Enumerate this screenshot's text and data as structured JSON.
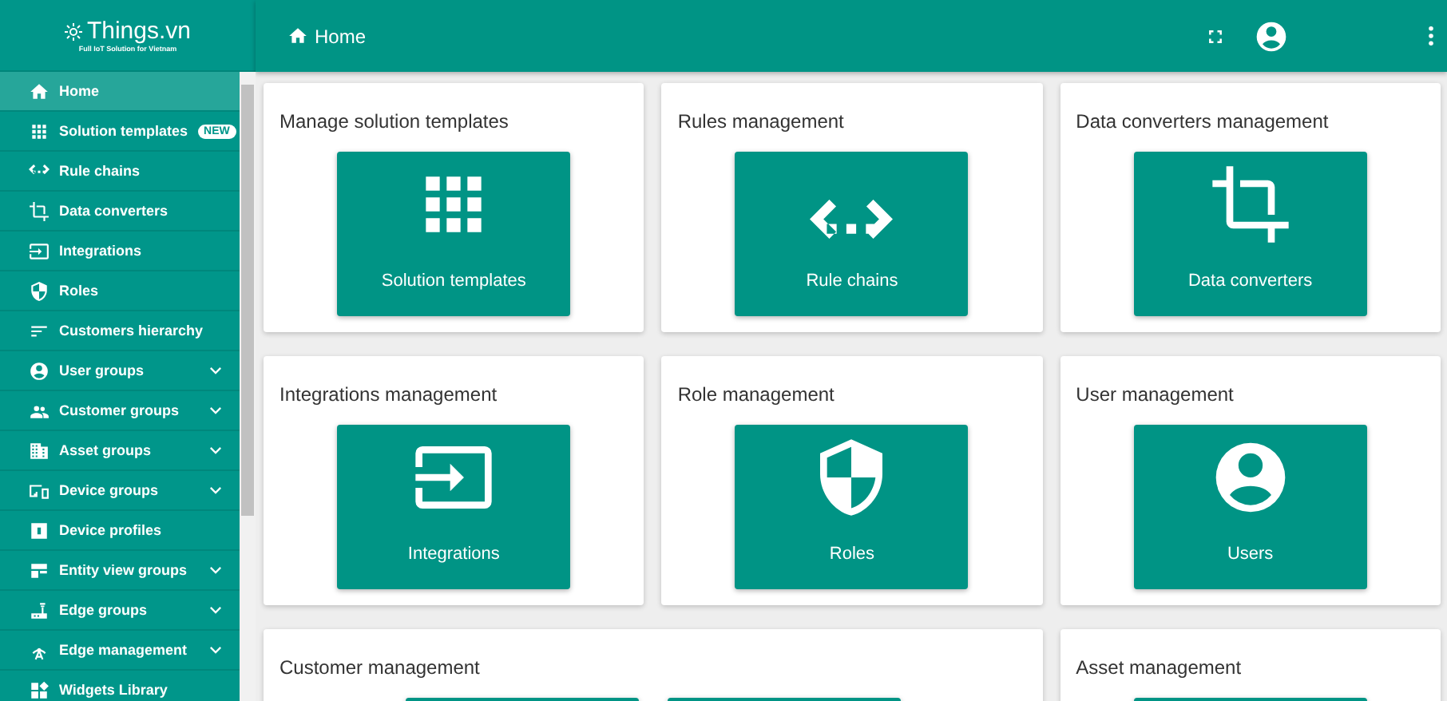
{
  "logo": {
    "name": "Things.vn",
    "tagline": "Full IoT Solution for Vietnam"
  },
  "sidebar": {
    "items": [
      {
        "label": "Home",
        "selected": true,
        "expandable": false
      },
      {
        "label": "Solution templates",
        "selected": false,
        "expandable": false,
        "badge": "NEW"
      },
      {
        "label": "Rule chains",
        "selected": false,
        "expandable": false
      },
      {
        "label": "Data converters",
        "selected": false,
        "expandable": false
      },
      {
        "label": "Integrations",
        "selected": false,
        "expandable": false
      },
      {
        "label": "Roles",
        "selected": false,
        "expandable": false
      },
      {
        "label": "Customers hierarchy",
        "selected": false,
        "expandable": false
      },
      {
        "label": "User groups",
        "selected": false,
        "expandable": true
      },
      {
        "label": "Customer groups",
        "selected": false,
        "expandable": true
      },
      {
        "label": "Asset groups",
        "selected": false,
        "expandable": true
      },
      {
        "label": "Device groups",
        "selected": false,
        "expandable": true
      },
      {
        "label": "Device profiles",
        "selected": false,
        "expandable": false
      },
      {
        "label": "Entity view groups",
        "selected": false,
        "expandable": true
      },
      {
        "label": "Edge groups",
        "selected": false,
        "expandable": true
      },
      {
        "label": "Edge management",
        "selected": false,
        "expandable": true
      },
      {
        "label": "Widgets Library",
        "selected": false,
        "expandable": false
      }
    ]
  },
  "header": {
    "title": "Home"
  },
  "sections": [
    {
      "title": "Manage solution templates",
      "tiles": [
        {
          "kind": "tile",
          "label": "Solution templates"
        }
      ]
    },
    {
      "title": "Rules management",
      "tiles": [
        {
          "kind": "tile",
          "label": "Rule chains"
        }
      ]
    },
    {
      "title": "Data converters management",
      "tiles": [
        {
          "kind": "tile",
          "label": "Data converters"
        }
      ]
    },
    {
      "title": "Integrations management",
      "tiles": [
        {
          "kind": "tile",
          "label": "Integrations"
        }
      ]
    },
    {
      "title": "Role management",
      "tiles": [
        {
          "kind": "tile",
          "label": "Roles"
        }
      ]
    },
    {
      "title": "User management",
      "tiles": [
        {
          "kind": "tile",
          "label": "Users"
        }
      ]
    },
    {
      "title": "Customer management",
      "wide": true,
      "tiles": [
        {
          "kind": "cut"
        },
        {
          "kind": "cut"
        }
      ]
    },
    {
      "title": "Asset management",
      "tiles": [
        {
          "kind": "cut"
        }
      ]
    }
  ]
}
